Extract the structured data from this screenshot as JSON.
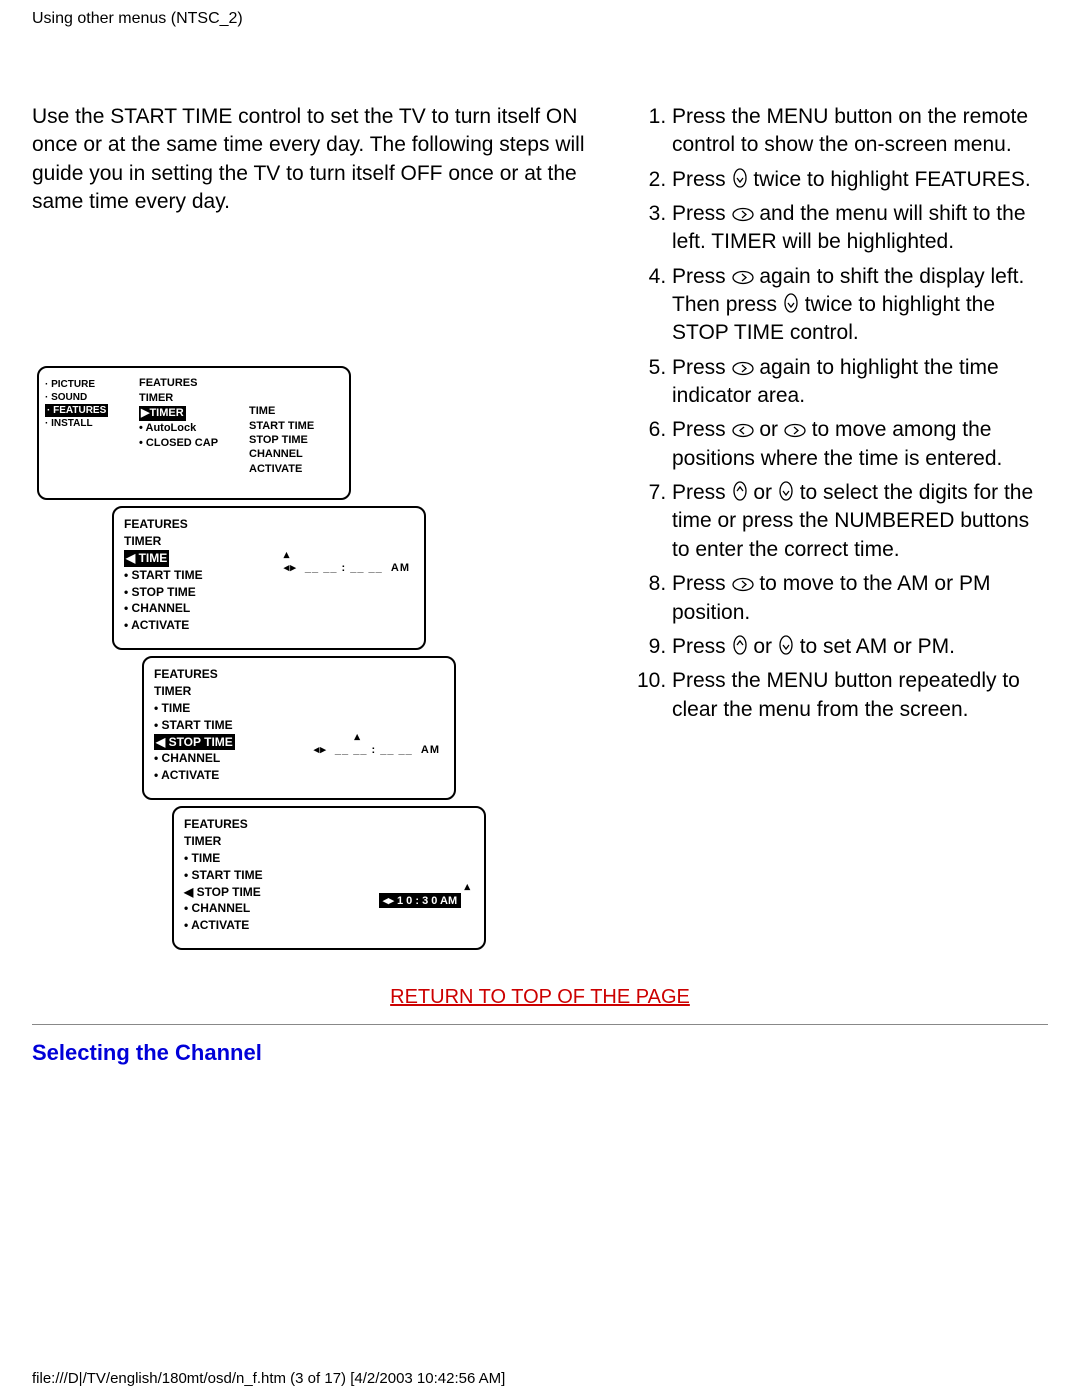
{
  "header": "Using other menus (NTSC_2)",
  "intro": "Use the START TIME control to set the TV to turn itself ON once or at the same time every day. The following steps will guide you in setting the TV to turn itself OFF once or at the same time every day.",
  "steps": {
    "s1": "Press the MENU button on the remote control to show the on-screen menu.",
    "s2a": "Press ",
    "s2b": " twice to highlight FEATURES.",
    "s3a": "Press ",
    "s3b": " and the menu will shift to the left. TIMER will be highlighted.",
    "s4a": "Press ",
    "s4b": " again to shift the display left. Then press ",
    "s4c": " twice to highlight the STOP TIME control.",
    "s5a": "Press ",
    "s5b": " again to highlight the time indicator area.",
    "s6a": "Press ",
    "s6b": " or ",
    "s6c": " to move among the positions where the time is entered.",
    "s7a": "Press ",
    "s7b": " or ",
    "s7c": " to select the digits for the time or press the NUMBERED buttons to enter the correct time.",
    "s8a": "Press ",
    "s8b": " to move to the AM or PM position.",
    "s9a": "Press ",
    "s9b": " or ",
    "s9c": " to set AM or PM.",
    "s10": "Press the MENU button repeatedly to clear the menu from the screen."
  },
  "diagram": {
    "menu1": {
      "sidebar": [
        "· PICTURE",
        "· SOUND",
        "· FEATURES",
        "· INSTALL"
      ],
      "col2_features": "FEATURES",
      "col2_timer": "TIMER",
      "col2_timer_hl": "▶TIMER",
      "col2_autolock": "• AutoLock",
      "col2_cc": "• CLOSED CAP",
      "col3": [
        "TIME",
        "START TIME",
        "STOP TIME",
        "CHANNEL",
        "ACTIVATE"
      ]
    },
    "menu2": {
      "features": "FEATURES",
      "timer": "TIMER",
      "time_hl": "◀ TIME",
      "items": [
        "• START TIME",
        "• STOP TIME",
        "• CHANNEL",
        "• ACTIVATE"
      ],
      "time_blank": "__ __ : __ __  AM"
    },
    "menu3": {
      "features": "FEATURES",
      "timer": "TIMER",
      "items_top": [
        "• TIME",
        "• START TIME"
      ],
      "stop_hl": "◀ STOP TIME",
      "items_bot": [
        "• CHANNEL",
        "• ACTIVATE"
      ],
      "time_blank": "◂▸  __ __ : __ __  AM"
    },
    "menu4": {
      "features": "FEATURES",
      "timer": "TIMER",
      "items_top": [
        "• TIME",
        "• START TIME"
      ],
      "stop": "◀ STOP TIME",
      "items_bot": [
        "• CHANNEL",
        "• ACTIVATE"
      ],
      "time_set": "◂▸  1 0 : 3 0  AM"
    }
  },
  "return_link": "RETURN TO TOP OF THE PAGE",
  "section_title": "Selecting the Channel",
  "footer": "file:///D|/TV/english/180mt/osd/n_f.htm (3 of 17) [4/2/2003 10:42:56 AM]"
}
